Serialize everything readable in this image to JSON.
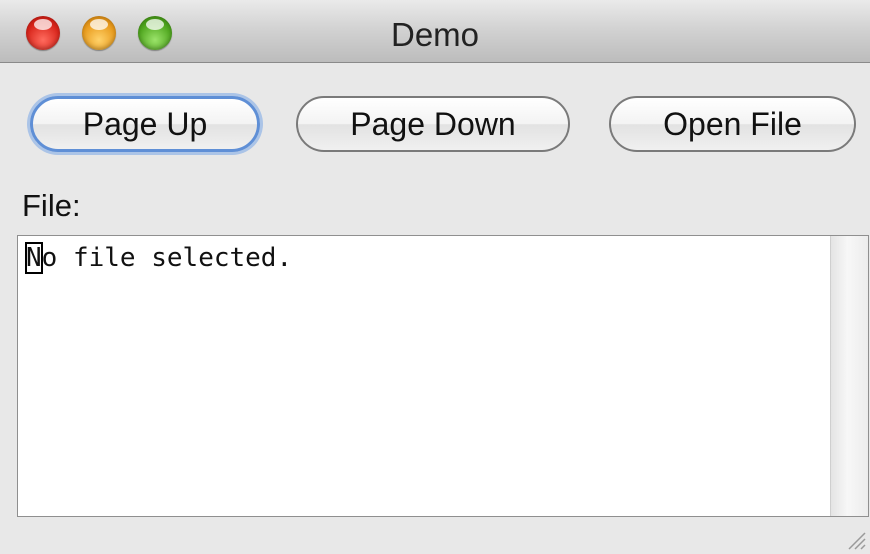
{
  "window": {
    "title": "Demo"
  },
  "toolbar": {
    "page_up_label": "Page Up",
    "page_down_label": "Page Down",
    "open_file_label": "Open File"
  },
  "file_section": {
    "label": "File:",
    "text_first_char": "N",
    "text_rest": "o file selected."
  },
  "icons": {
    "close": "close-icon",
    "minimize": "minimize-icon",
    "zoom": "zoom-icon",
    "resize": "resize-grip-icon"
  },
  "colors": {
    "focus_ring": "#5f8fd6",
    "close": "#d8241a",
    "minimize": "#e89a1c",
    "zoom": "#4ea51d"
  }
}
